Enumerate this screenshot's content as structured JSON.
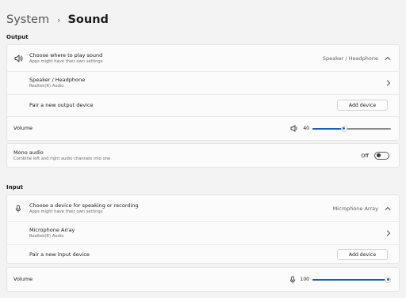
{
  "breadcrumb": {
    "parent": "System",
    "separator": "›",
    "current": "Sound"
  },
  "output": {
    "section_title": "Output",
    "choose": {
      "title": "Choose where to play sound",
      "subtitle": "Apps might have their own settings",
      "value": "Speaker / Headphone"
    },
    "device": {
      "name": "Speaker / Headphone",
      "driver": "Realtek(R) Audio"
    },
    "pair": {
      "label": "Pair a new output device",
      "button": "Add device"
    },
    "volume": {
      "label": "Volume",
      "value": "40",
      "level": 0.4
    },
    "mono": {
      "title": "Mono audio",
      "subtitle": "Combine left and right audio channels into one",
      "state": "Off"
    }
  },
  "input": {
    "section_title": "Input",
    "choose": {
      "title": "Choose a device for speaking or recording",
      "subtitle": "Apps might have their own settings",
      "value": "Microphone Array"
    },
    "device": {
      "name": "Microphone Array",
      "driver": "Realtek(R) Audio"
    },
    "pair": {
      "label": "Pair a new input device",
      "button": "Add device"
    },
    "volume": {
      "label": "Volume",
      "value": "100",
      "level": 1.0
    }
  },
  "colors": {
    "accent": "#1a5fb4",
    "background": "#f3f3f3",
    "card": "#fbfbfb"
  },
  "icons": [
    "chevron-right-icon",
    "speaker-icon",
    "chevron-up-icon",
    "microphone-icon"
  ]
}
